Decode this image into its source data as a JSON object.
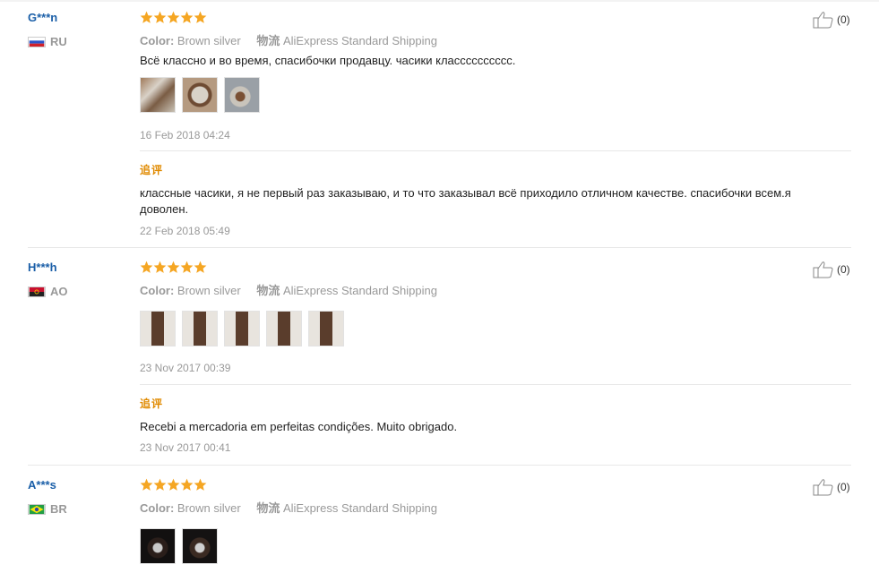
{
  "reviews": [
    {
      "user": "G***n",
      "country": "RU",
      "flag_colors": [
        "#ffffff",
        "#2b52c8",
        "#d0202a"
      ],
      "rating": 5,
      "color_label": "Color:",
      "color_value": "Brown silver",
      "shipping_label": "物流",
      "shipping_value": "AliExpress Standard Shipping",
      "text": "Всё классно и во время, спасибочки продавцу. часики класссссссссс.",
      "images": [
        "photo-1",
        "photo-2",
        "photo-3"
      ],
      "date": "16 Feb 2018 04:24",
      "followup_label": "追评",
      "followup_text": "классные часики, я не первый раз заказываю, и то что заказывал всё приходило отличном качестве. спасибочки всем.я доволен.",
      "followup_date": "22 Feb 2018 05:49",
      "likes": "(0)"
    },
    {
      "user": "H***h",
      "country": "AO",
      "flag_colors": [
        "#c8102e",
        "#222222",
        "#f4c400"
      ],
      "rating": 5,
      "color_label": "Color:",
      "color_value": "Brown silver",
      "shipping_label": "物流",
      "shipping_value": "AliExpress Standard Shipping",
      "text": "",
      "images": [
        "photo-1",
        "photo-2",
        "photo-3",
        "photo-4",
        "photo-5"
      ],
      "date": "23 Nov 2017 00:39",
      "followup_label": "追评",
      "followup_text": "Recebi a mercadoria em perfeitas condições. Muito obrigado.",
      "followup_date": "23 Nov 2017 00:41",
      "likes": "(0)"
    },
    {
      "user": "A***s",
      "country": "BR",
      "flag_colors": [
        "#229e45",
        "#f8e509",
        "#2b49a3"
      ],
      "rating": 5,
      "color_label": "Color:",
      "color_value": "Brown silver",
      "shipping_label": "物流",
      "shipping_value": "AliExpress Standard Shipping",
      "images": [
        "photo-1",
        "photo-2"
      ],
      "likes": "(0)"
    }
  ],
  "colors": {
    "username": "#1b5fa8",
    "star": "#f5a623",
    "followup": "#e08a00",
    "muted": "#999999"
  }
}
